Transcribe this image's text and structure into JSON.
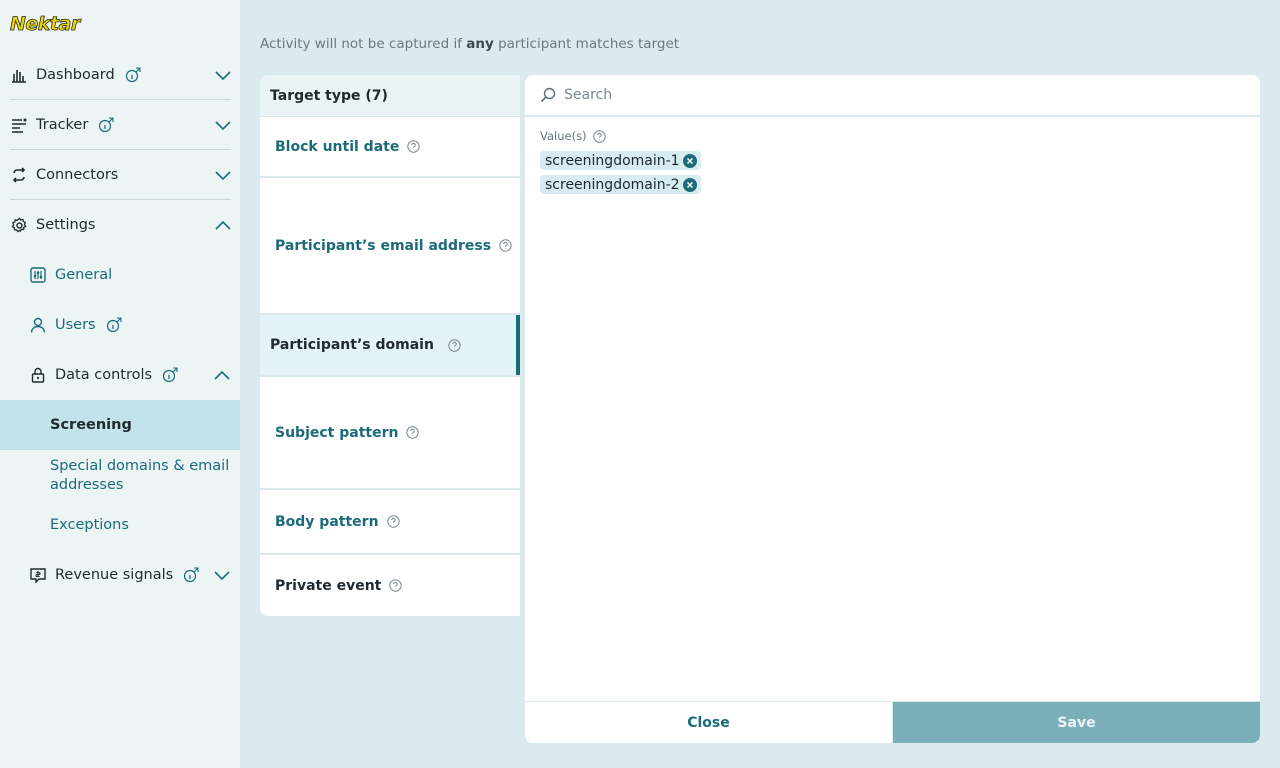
{
  "app": {
    "logo_text": "Nektar"
  },
  "sidebar": {
    "dashboard": "Dashboard",
    "tracker": "Tracker",
    "connectors": "Connectors",
    "settings": "Settings",
    "general": "General",
    "users": "Users",
    "data_controls": "Data controls",
    "screening": "Screening",
    "special_domains": "Special domains & email addresses",
    "exceptions": "Exceptions",
    "revenue_signals": "Revenue signals"
  },
  "notice": {
    "prefix": "Activity will not be captured if ",
    "emphasis": "any",
    "suffix": " participant matches target"
  },
  "target_panel": {
    "header": "Target type (7)",
    "items": [
      "Block until date",
      "Participant’s email address",
      "Participant’s domain",
      "Subject pattern",
      "Body pattern",
      "Private event"
    ]
  },
  "values_panel": {
    "search_placeholder": "Search",
    "values_label": "Value(s)",
    "chips": [
      "screeningdomain-1",
      "screeningdomain-2"
    ],
    "close_label": "Close",
    "save_label": "Save"
  },
  "colors": {
    "accent": "#1b6b78",
    "save_button": "#7aaeb9",
    "active_row": "#c2e3ec"
  }
}
